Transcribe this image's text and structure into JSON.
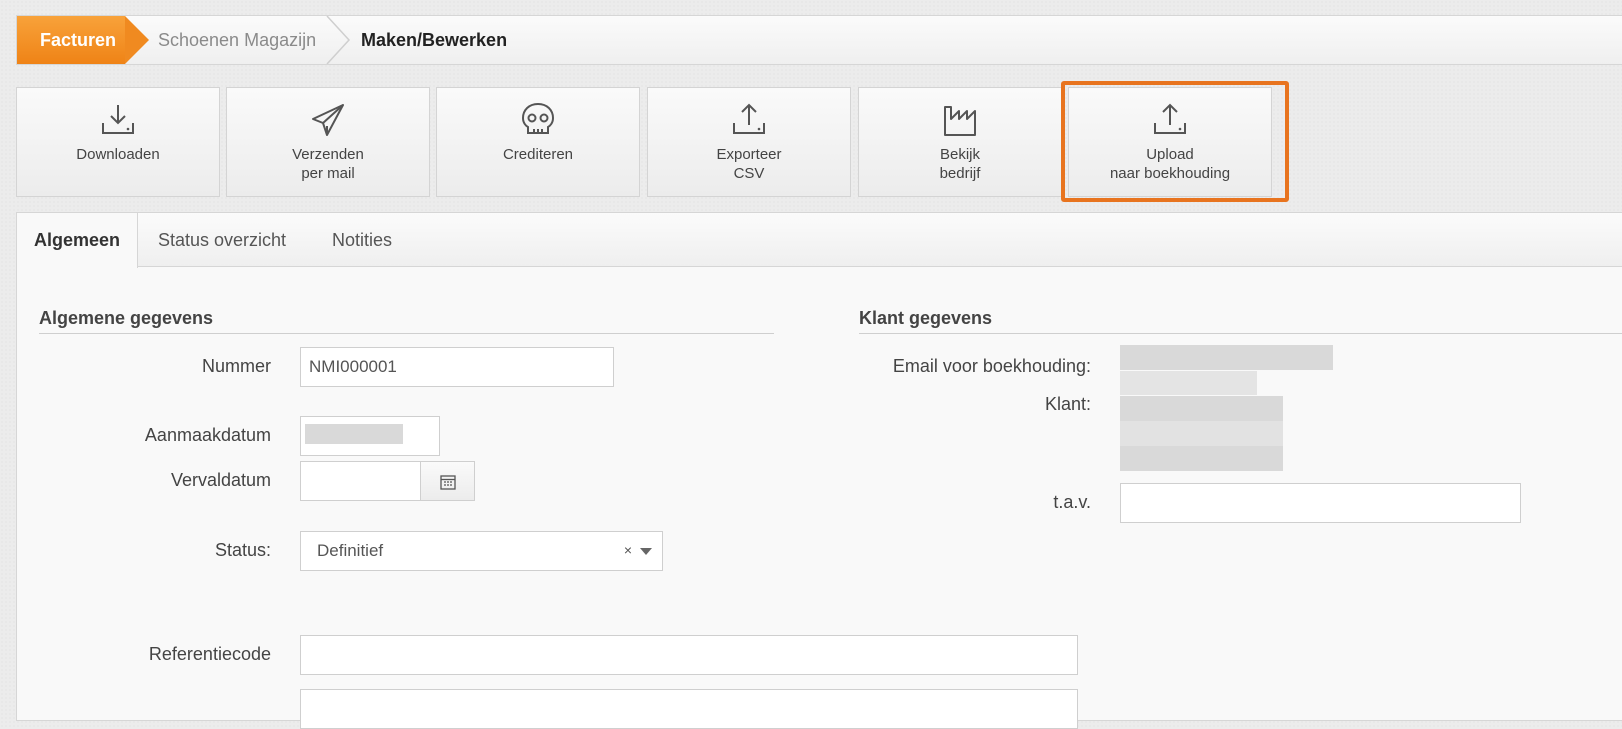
{
  "breadcrumb": {
    "root": "Facturen",
    "middle": "Schoenen Magazijn",
    "current": "Maken/Bewerken"
  },
  "toolbar": {
    "buttons": [
      {
        "line1": "Downloaden",
        "line2": "",
        "icon": "download-icon"
      },
      {
        "line1": "Verzenden",
        "line2": "per mail",
        "icon": "paper-plane-icon"
      },
      {
        "line1": "Crediteren",
        "line2": "",
        "icon": "skull-icon"
      },
      {
        "line1": "Exporteer",
        "line2": "CSV",
        "icon": "export-icon"
      },
      {
        "line1": "Bekijk",
        "line2": "bedrijf",
        "icon": "factory-icon"
      },
      {
        "line1": "Upload",
        "line2": "naar boekhouding",
        "icon": "upload-icon"
      }
    ],
    "highlight_color": "#e8741f"
  },
  "tabs": [
    "Algemeen",
    "Status overzicht",
    "Notities"
  ],
  "general": {
    "title": "Algemene gegevens",
    "nummer_label": "Nummer",
    "nummer_value": "NMI000001",
    "aanmaakdatum_label": "Aanmaakdatum",
    "vervaldatum_label": "Vervaldatum",
    "status_label": "Status:",
    "status_value": "Definitief",
    "status_clear": "×",
    "referentie_label": "Referentiecode"
  },
  "client": {
    "title": "Klant gegevens",
    "email_label": "Email voor boekhouding:",
    "klant_label": "Klant:",
    "tav_label": "t.a.v."
  },
  "colors": {
    "accent": "#ef8316"
  }
}
